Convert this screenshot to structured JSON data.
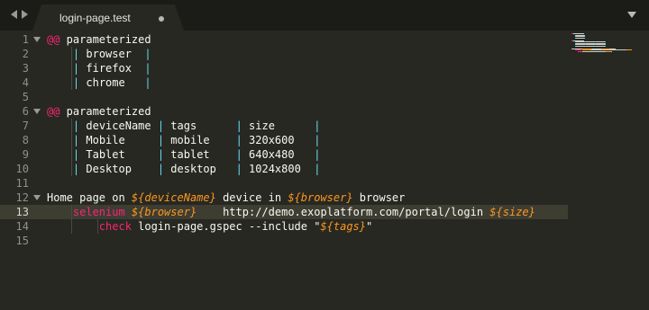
{
  "tab": {
    "title": "login-page.test"
  },
  "editor": {
    "current_line": 13,
    "lines": [
      {
        "n": "1",
        "fold": true,
        "tokens": [
          {
            "t": "@@",
            "c": "t-at"
          },
          {
            "t": " parameterized"
          }
        ]
      },
      {
        "n": "2",
        "tokens": [
          {
            "t": "    "
          },
          {
            "t": "|",
            "c": "t-pipe"
          },
          {
            "t": " browser  "
          },
          {
            "t": "|",
            "c": "t-pipe"
          }
        ]
      },
      {
        "n": "3",
        "tokens": [
          {
            "t": "    "
          },
          {
            "t": "|",
            "c": "t-pipe"
          },
          {
            "t": " firefox  "
          },
          {
            "t": "|",
            "c": "t-pipe"
          }
        ]
      },
      {
        "n": "4",
        "tokens": [
          {
            "t": "    "
          },
          {
            "t": "|",
            "c": "t-pipe"
          },
          {
            "t": " chrome   "
          },
          {
            "t": "|",
            "c": "t-pipe"
          }
        ]
      },
      {
        "n": "5",
        "tokens": []
      },
      {
        "n": "6",
        "fold": true,
        "tokens": [
          {
            "t": "@@",
            "c": "t-at"
          },
          {
            "t": " parameterized"
          }
        ]
      },
      {
        "n": "7",
        "tokens": [
          {
            "t": "    "
          },
          {
            "t": "|",
            "c": "t-pipe"
          },
          {
            "t": " deviceName "
          },
          {
            "t": "|",
            "c": "t-pipe"
          },
          {
            "t": " tags      "
          },
          {
            "t": "|",
            "c": "t-pipe"
          },
          {
            "t": " size      "
          },
          {
            "t": "|",
            "c": "t-pipe"
          }
        ]
      },
      {
        "n": "8",
        "tokens": [
          {
            "t": "    "
          },
          {
            "t": "|",
            "c": "t-pipe"
          },
          {
            "t": " Mobile     "
          },
          {
            "t": "|",
            "c": "t-pipe"
          },
          {
            "t": " mobile    "
          },
          {
            "t": "|",
            "c": "t-pipe"
          },
          {
            "t": " 320x600   "
          },
          {
            "t": "|",
            "c": "t-pipe"
          }
        ]
      },
      {
        "n": "9",
        "tokens": [
          {
            "t": "    "
          },
          {
            "t": "|",
            "c": "t-pipe"
          },
          {
            "t": " Tablet     "
          },
          {
            "t": "|",
            "c": "t-pipe"
          },
          {
            "t": " tablet    "
          },
          {
            "t": "|",
            "c": "t-pipe"
          },
          {
            "t": " 640x480   "
          },
          {
            "t": "|",
            "c": "t-pipe"
          }
        ]
      },
      {
        "n": "10",
        "tokens": [
          {
            "t": "    "
          },
          {
            "t": "|",
            "c": "t-pipe"
          },
          {
            "t": " Desktop    "
          },
          {
            "t": "|",
            "c": "t-pipe"
          },
          {
            "t": " desktop   "
          },
          {
            "t": "|",
            "c": "t-pipe"
          },
          {
            "t": " 1024x800  "
          },
          {
            "t": "|",
            "c": "t-pipe"
          }
        ]
      },
      {
        "n": "11",
        "tokens": []
      },
      {
        "n": "12",
        "fold": true,
        "tokens": [
          {
            "t": "Home page on "
          },
          {
            "t": "${deviceName}",
            "c": "t-var"
          },
          {
            "t": " device in "
          },
          {
            "t": "${browser}",
            "c": "t-var"
          },
          {
            "t": " browser"
          }
        ]
      },
      {
        "n": "13",
        "tokens": [
          {
            "t": "    "
          },
          {
            "t": "selenium",
            "c": "t-kw"
          },
          {
            "t": " "
          },
          {
            "t": "${browser}",
            "c": "t-var"
          },
          {
            "t": "    http://demo.exoplatform.com/portal/login "
          },
          {
            "t": "${size}",
            "c": "t-var"
          }
        ]
      },
      {
        "n": "14",
        "tokens": [
          {
            "t": "        "
          },
          {
            "t": "check",
            "c": "t-kw"
          },
          {
            "t": " login-page.gspec --include \""
          },
          {
            "t": "${tags}",
            "c": "t-var"
          },
          {
            "t": "\""
          }
        ]
      },
      {
        "n": "15",
        "tokens": []
      }
    ]
  },
  "colors": {
    "background": "#272822",
    "tabbar": "#1b1c18",
    "pipe": "#66d9ef",
    "keyword": "#f92672",
    "variable": "#fd971f",
    "text": "#f8f8f2",
    "line_highlight": "#3e3d32"
  }
}
